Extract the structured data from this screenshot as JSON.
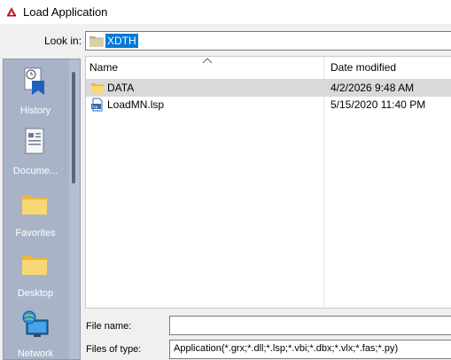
{
  "window": {
    "title": "Load Application",
    "app_icon": "autocad-app-icon"
  },
  "look_in": {
    "label": "Look in:",
    "value": "XDTH",
    "icon": "folder-icon"
  },
  "places": [
    {
      "label": "History",
      "icon": "history-icon"
    },
    {
      "label": "Docume...",
      "icon": "documents-icon"
    },
    {
      "label": "Favorites",
      "icon": "favorites-folder-icon"
    },
    {
      "label": "Desktop",
      "icon": "desktop-folder-icon"
    },
    {
      "label": "Network",
      "icon": "network-icon"
    }
  ],
  "file_list": {
    "columns": {
      "name": "Name",
      "date_modified": "Date modified"
    },
    "rows": [
      {
        "name": "DATA",
        "date": "4/2/2026 9:48 AM",
        "icon": "folder-icon",
        "selected": true
      },
      {
        "name": "LoadMN.lsp",
        "date": "5/15/2020 11:40 PM",
        "icon": "lisp-file-icon",
        "selected": false
      }
    ]
  },
  "file_name": {
    "label": "File name:",
    "value": ""
  },
  "files_of_type": {
    "label": "Files of type:",
    "value": "Application(*.grx;*.dll;*.lsp;*.vbi;*.dbx;*.vlx;*.fas;*.py)"
  },
  "colors": {
    "places_bg": "#a9b3c8",
    "selection": "#0078d7",
    "row_selected": "#d9d9d9",
    "folder": "#f8d775"
  }
}
